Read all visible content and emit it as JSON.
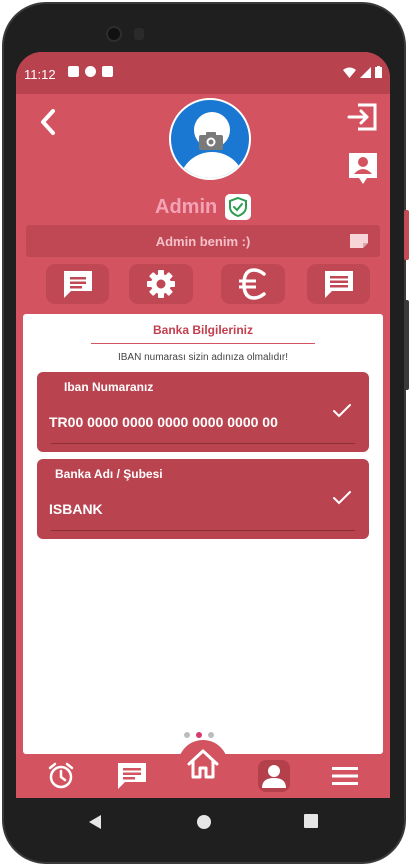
{
  "status": {
    "time": "11:12"
  },
  "profile": {
    "username": "Admin",
    "bio": "Admin benim :)"
  },
  "bank": {
    "title": "Banka Bilgileriniz",
    "note": "IBAN numarası sizin adınıza olmalıdır!",
    "fields": [
      {
        "label": "Iban Numaranız",
        "value": "TR00 0000 0000 0000 0000 0000 00"
      },
      {
        "label": "Banka Adı / Şubesi",
        "value": "ISBANK"
      }
    ]
  },
  "pager": {
    "pages": 3,
    "active": 2
  },
  "colors": {
    "primary": "#d35460",
    "dark": "#b94450",
    "accent": "#d63a73",
    "avatar_bg": "#1a78d2",
    "verified": "#2e9d4f"
  },
  "icons": {
    "top": [
      "back-arrow-icon",
      "exit-icon",
      "contact-card-icon",
      "camera-icon",
      "verified-shield-icon",
      "edit-note-icon"
    ],
    "quick": [
      "message-icon",
      "gear-icon",
      "euro-icon",
      "comment-icon"
    ],
    "nav": [
      "alarm-clock-icon",
      "chat-icon",
      "home-icon",
      "person-icon",
      "menu-icon"
    ]
  }
}
